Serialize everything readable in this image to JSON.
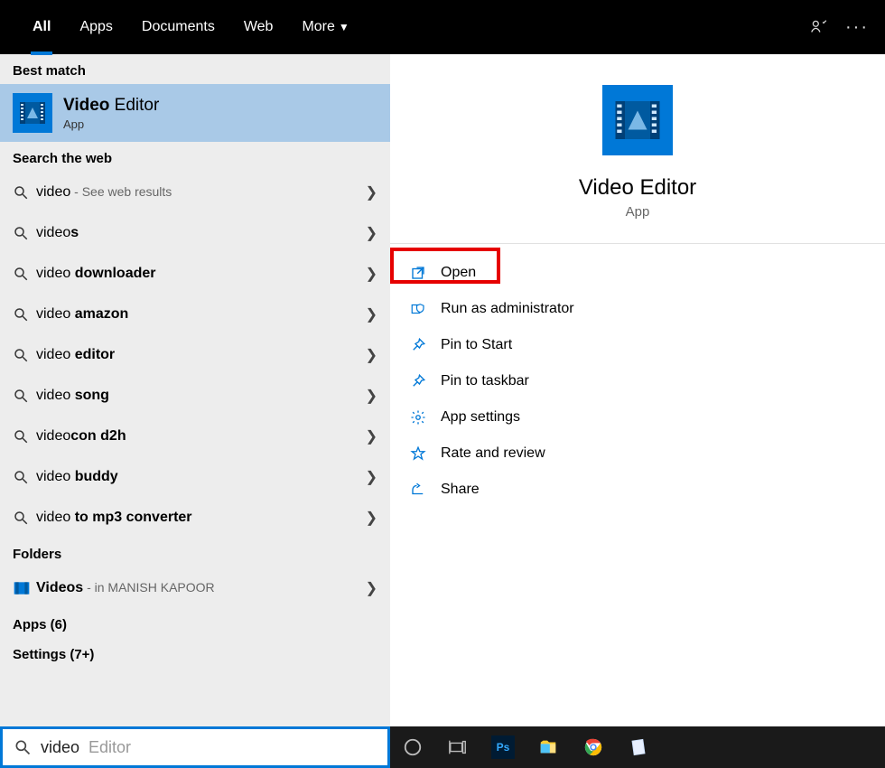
{
  "topbar": {
    "tabs": [
      "All",
      "Apps",
      "Documents",
      "Web",
      "More"
    ]
  },
  "left": {
    "best_match_label": "Best match",
    "selected": {
      "title_prefix": "Video",
      "title_rest": " Editor",
      "subtitle": "App"
    },
    "web_label": "Search the web",
    "web_results": [
      {
        "prefix": "video",
        "bold": "",
        "suffix": "",
        "hint": " - See web results"
      },
      {
        "prefix": "video",
        "bold": "s",
        "suffix": "",
        "hint": ""
      },
      {
        "prefix": "video ",
        "bold": "downloader",
        "suffix": "",
        "hint": ""
      },
      {
        "prefix": "video ",
        "bold": "amazon",
        "suffix": "",
        "hint": ""
      },
      {
        "prefix": "video ",
        "bold": "editor",
        "suffix": "",
        "hint": ""
      },
      {
        "prefix": "video ",
        "bold": "song",
        "suffix": "",
        "hint": ""
      },
      {
        "prefix": "video",
        "bold": "con d2h",
        "suffix": "",
        "hint": ""
      },
      {
        "prefix": "video ",
        "bold": "buddy",
        "suffix": "",
        "hint": ""
      },
      {
        "prefix": "video ",
        "bold": "to mp3 converter",
        "suffix": "",
        "hint": ""
      }
    ],
    "folders_label": "Folders",
    "folder": {
      "prefix": "Video",
      "bold": "s",
      "hint": " - in MANISH KAPOOR"
    },
    "apps_label": "Apps (6)",
    "settings_label": "Settings (7+)"
  },
  "right": {
    "title": "Video Editor",
    "subtitle": "App",
    "actions": [
      {
        "icon": "open",
        "label": "Open"
      },
      {
        "icon": "shield",
        "label": "Run as administrator"
      },
      {
        "icon": "pin",
        "label": "Pin to Start"
      },
      {
        "icon": "pin",
        "label": "Pin to taskbar"
      },
      {
        "icon": "gear",
        "label": "App settings"
      },
      {
        "icon": "star",
        "label": "Rate and review"
      },
      {
        "icon": "share",
        "label": "Share"
      }
    ],
    "highlight_index": 0
  },
  "search": {
    "typed": "video",
    "ghost": " Editor"
  },
  "taskbar_icons": [
    "cortana",
    "taskview",
    "photoshop",
    "explorer",
    "chrome",
    "notes"
  ]
}
